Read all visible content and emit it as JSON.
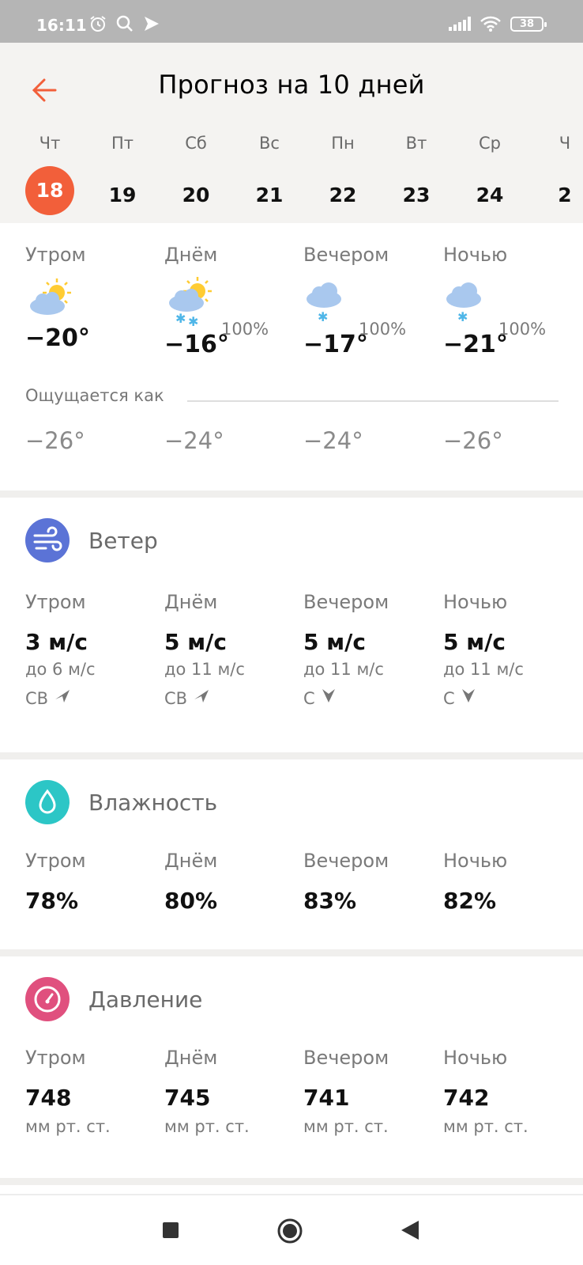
{
  "status_bar": {
    "time": "16:11",
    "battery": "38"
  },
  "header": {
    "title": "Прогноз на 10 дней",
    "days": [
      {
        "weekday": "Чт",
        "num": "18",
        "active": true
      },
      {
        "weekday": "Пт",
        "num": "19"
      },
      {
        "weekday": "Сб",
        "num": "20"
      },
      {
        "weekday": "Вс",
        "num": "21"
      },
      {
        "weekday": "Пн",
        "num": "22"
      },
      {
        "weekday": "Вт",
        "num": "23"
      },
      {
        "weekday": "Ср",
        "num": "24"
      },
      {
        "weekday": "Ч",
        "num": "2"
      }
    ]
  },
  "temperature": {
    "periods": [
      {
        "label": "Утром",
        "icon": "partly-cloudy-icon",
        "temp": "−20°",
        "precip": "",
        "feels": "−26°"
      },
      {
        "label": "Днём",
        "icon": "partly-cloudy-snow-icon",
        "temp": "−16°",
        "precip": "100%",
        "feels": "−24°"
      },
      {
        "label": "Вечером",
        "icon": "cloud-snow-icon",
        "temp": "−17°",
        "precip": "100%",
        "feels": "−24°"
      },
      {
        "label": "Ночью",
        "icon": "cloud-snow-icon",
        "temp": "−21°",
        "precip": "100%",
        "feels": "−26°"
      }
    ],
    "feels_label": "Ощущается как"
  },
  "wind": {
    "title": "Ветер",
    "icon": "wind-icon",
    "periods": [
      {
        "label": "Утром",
        "speed": "3 м/с",
        "gust": "до 6 м/с",
        "dir": "СВ",
        "arrow": "arrow-northeast-icon"
      },
      {
        "label": "Днём",
        "speed": "5 м/с",
        "gust": "до 11 м/с",
        "dir": "СВ",
        "arrow": "arrow-northeast-icon"
      },
      {
        "label": "Вечером",
        "speed": "5 м/с",
        "gust": "до 11 м/с",
        "dir": "С",
        "arrow": "arrow-north-icon"
      },
      {
        "label": "Ночью",
        "speed": "5 м/с",
        "gust": "до 11 м/с",
        "dir": "С",
        "arrow": "arrow-north-icon"
      }
    ]
  },
  "humidity": {
    "title": "Влажность",
    "icon": "droplet-icon",
    "periods": [
      {
        "label": "Утром",
        "value": "78%"
      },
      {
        "label": "Днём",
        "value": "80%"
      },
      {
        "label": "Вечером",
        "value": "83%"
      },
      {
        "label": "Ночью",
        "value": "82%"
      }
    ]
  },
  "pressure": {
    "title": "Давление",
    "icon": "gauge-icon",
    "periods": [
      {
        "label": "Утром",
        "value": "748",
        "unit": "мм рт. ст."
      },
      {
        "label": "Днём",
        "value": "745",
        "unit": "мм рт. ст."
      },
      {
        "label": "Вечером",
        "value": "741",
        "unit": "мм рт. ст."
      },
      {
        "label": "Ночью",
        "value": "742",
        "unit": "мм рт. ст."
      }
    ]
  },
  "colors": {
    "accent": "#f25f3a",
    "wind": "#5b73d6",
    "humidity": "#2cc6c6",
    "pressure": "#e0507e"
  }
}
